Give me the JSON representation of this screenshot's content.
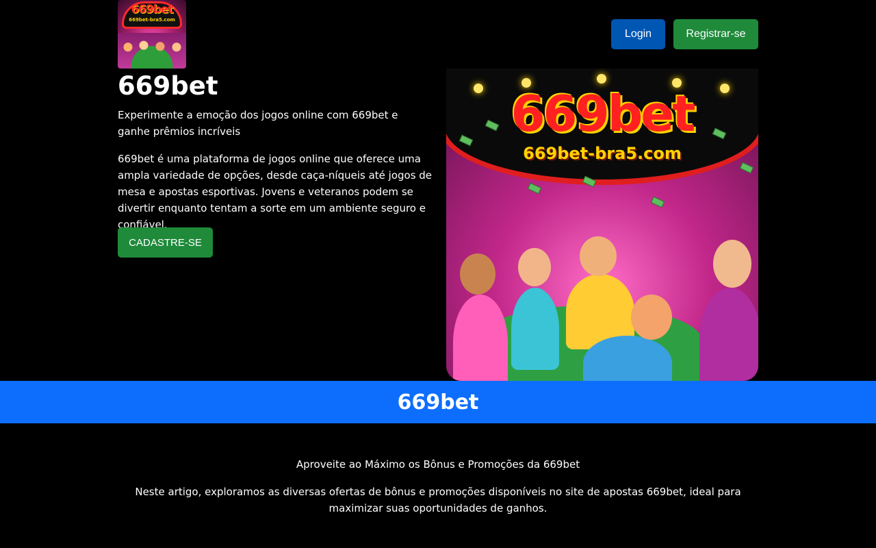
{
  "header": {
    "logo": {
      "title": "669bet",
      "subtitle": "669bet-bra5.com"
    },
    "login_label": "Login",
    "register_label": "Registrar-se"
  },
  "hero": {
    "title": "669bet",
    "subtitle": "Experimente a emoção dos jogos online com 669bet e ganhe prêmios incríveis",
    "body": "669bet é uma plataforma de jogos online que oferece uma ampla variedade de opções, desde caça-níqueis até jogos de mesa e apostas esportivas. Jovens e veteranos podem se divertir enquanto tentam a sorte em um ambiente seguro e confiável.",
    "cta_label": "CADASTRE-SE",
    "image": {
      "title": "669bet",
      "url_text": "669bet-bra5.com"
    }
  },
  "banner": {
    "title": "669bet"
  },
  "article": {
    "title": "Aproveite ao Máximo os Bônus e Promoções da 669bet",
    "body": "Neste artigo, exploramos as diversas ofertas de bônus e promoções disponíveis no site de apostas 669bet, ideal para maximizar suas oportunidades de ganhos."
  },
  "colors": {
    "background": "#000000",
    "login_button": "#0056b3",
    "register_button": "#1f8a3a",
    "banner": "#0d6efd"
  }
}
